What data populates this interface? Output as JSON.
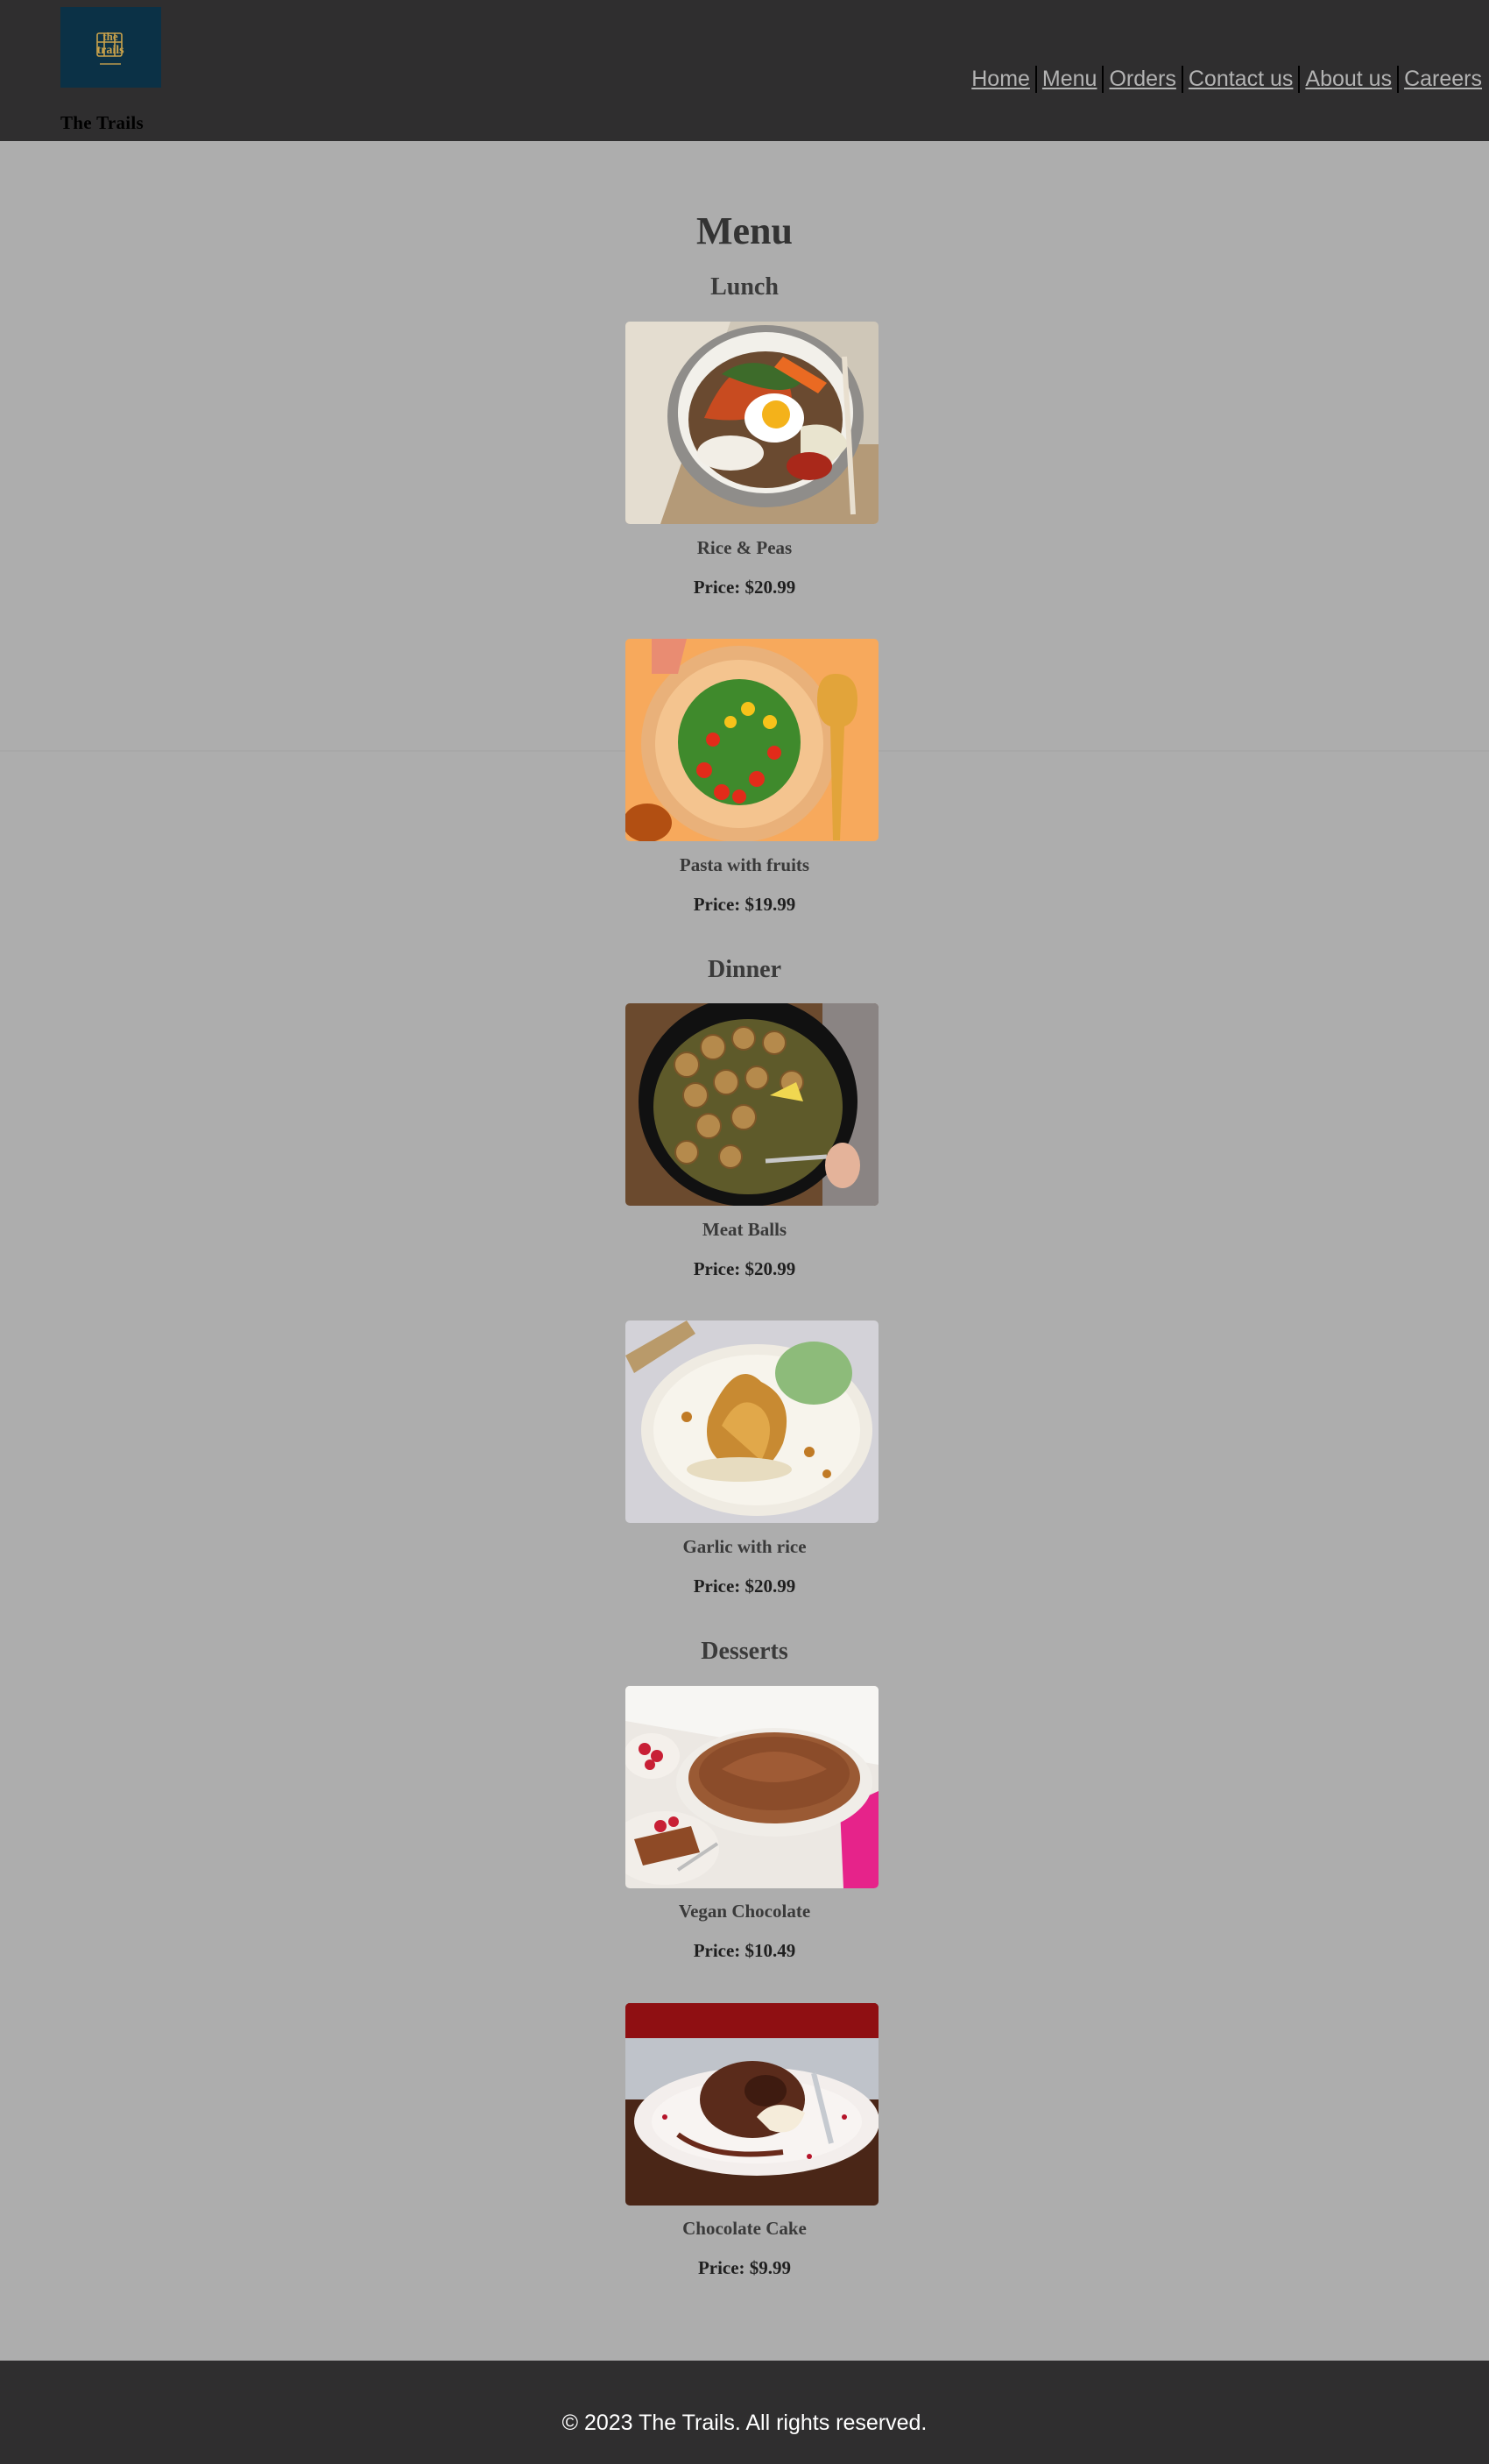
{
  "brand": {
    "name": "The Trails",
    "logo_lines": [
      "the",
      "trails"
    ]
  },
  "nav": [
    {
      "label": "Home"
    },
    {
      "label": "Menu"
    },
    {
      "label": "Orders"
    },
    {
      "label": "Contact us"
    },
    {
      "label": "About us"
    },
    {
      "label": "Careers"
    }
  ],
  "main": {
    "title": "Menu",
    "sections": [
      {
        "title": "Lunch",
        "items": [
          {
            "name": "Rice & Peas",
            "price": "Price: $20.99"
          },
          {
            "name": "Pasta with fruits",
            "price": "Price: $19.99"
          }
        ]
      },
      {
        "title": "Dinner",
        "items": [
          {
            "name": "Meat Balls",
            "price": "Price: $20.99"
          },
          {
            "name": "Garlic with rice",
            "price": "Price: $20.99"
          }
        ]
      },
      {
        "title": "Desserts",
        "items": [
          {
            "name": "Vegan Chocolate",
            "price": "Price: $10.49"
          },
          {
            "name": "Chocolate Cake",
            "price": "Price: $9.99"
          }
        ]
      }
    ]
  },
  "footer": {
    "text": "© 2023 The Trails. All rights reserved."
  },
  "colors": {
    "header_bg": "#2f2e2f",
    "page_bg": "#adadad",
    "nav_link": "#b3b3b3",
    "logo_bg": "#0b3146",
    "logo_gold": "#c9a24b"
  }
}
